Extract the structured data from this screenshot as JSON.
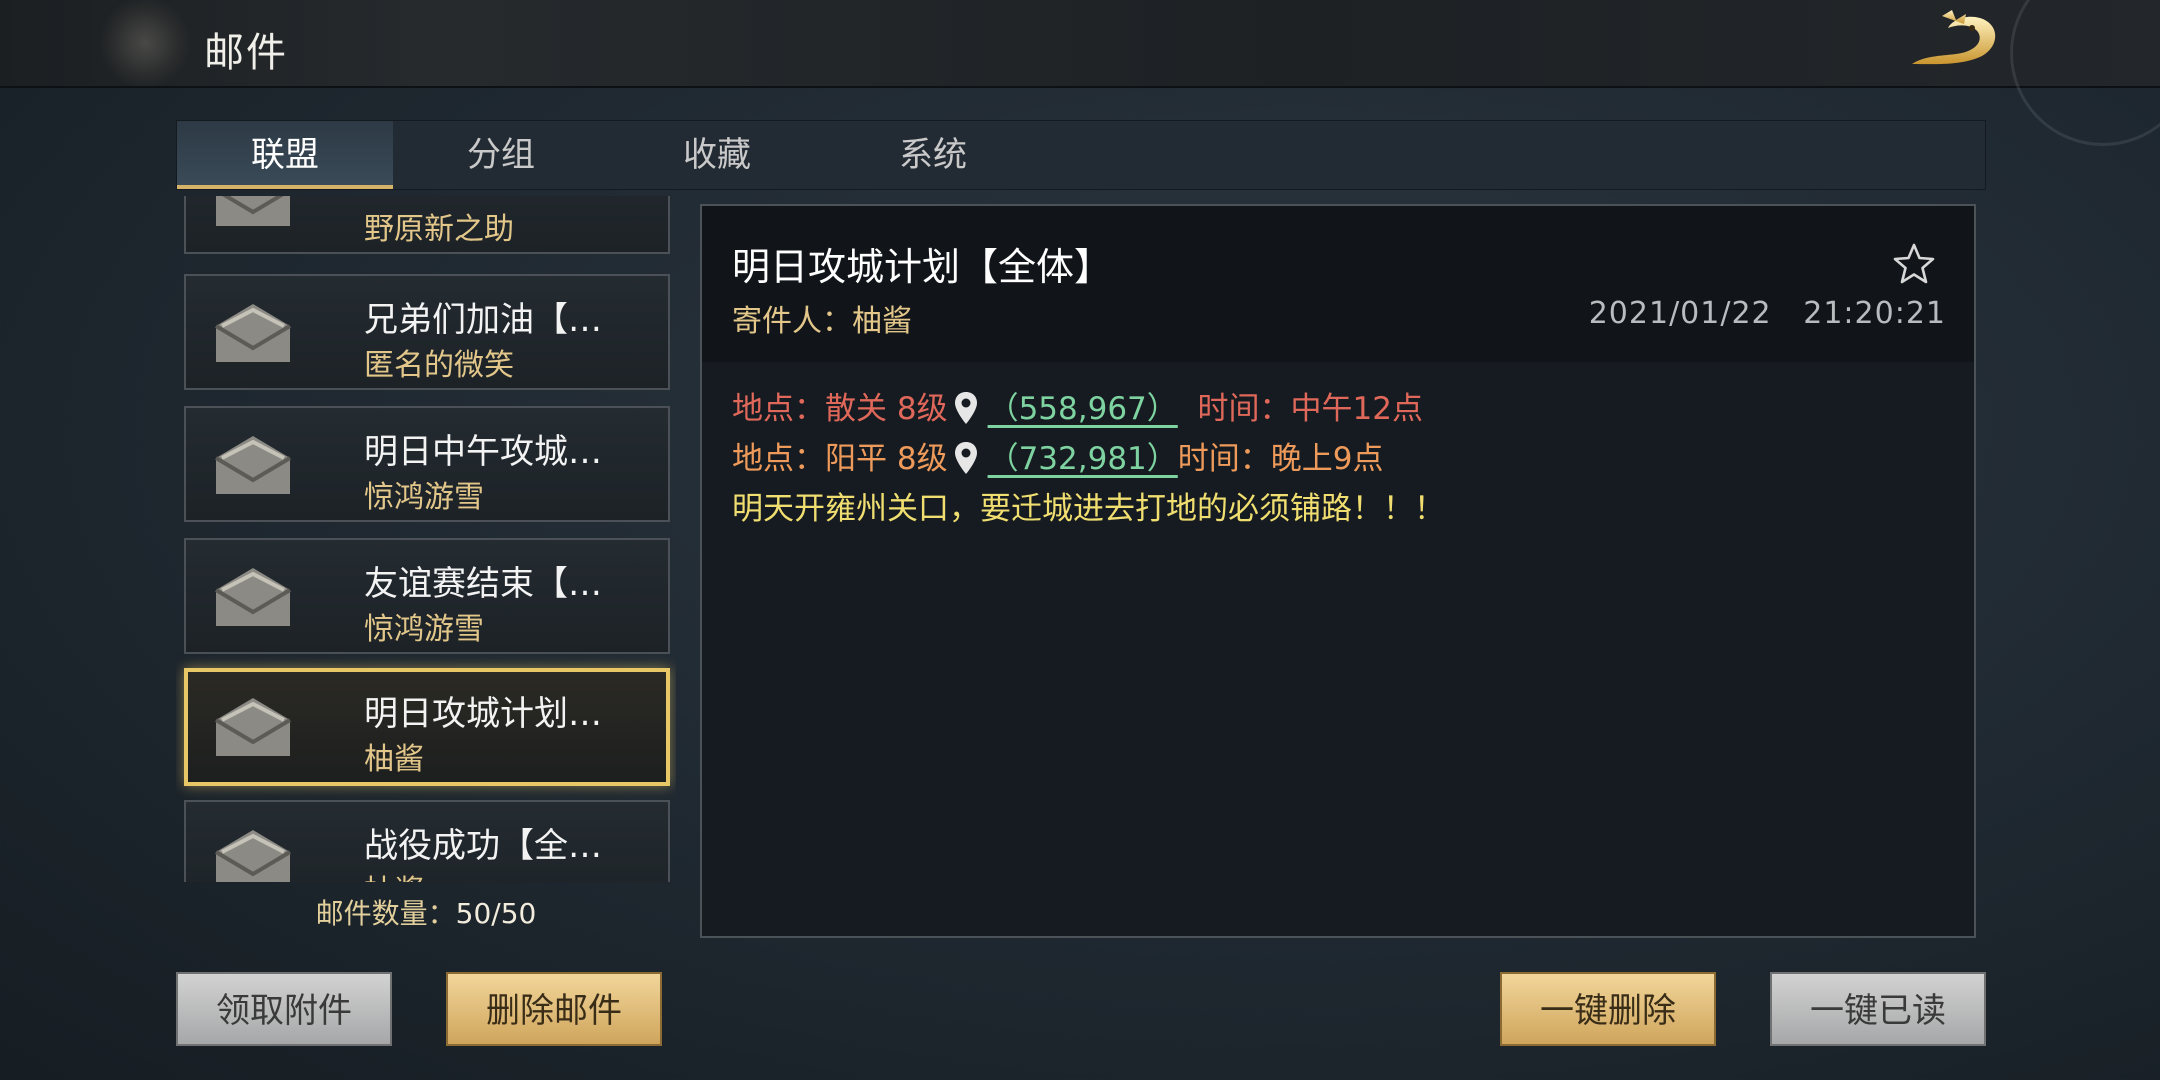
{
  "header": {
    "title": "邮件"
  },
  "tabs": [
    {
      "label": "联盟",
      "active": true
    },
    {
      "label": "分组",
      "active": false
    },
    {
      "label": "收藏",
      "active": false
    },
    {
      "label": "系统",
      "active": false
    }
  ],
  "mails": [
    {
      "subject": "",
      "sender": "野原新之助"
    },
    {
      "subject": "兄弟们加油【…",
      "sender": "匿名的微笑"
    },
    {
      "subject": "明日中午攻城…",
      "sender": "惊鸿游雪"
    },
    {
      "subject": "友谊赛结束【…",
      "sender": "惊鸿游雪"
    },
    {
      "subject": "明日攻城计划…",
      "sender": "柚酱",
      "selected": true
    },
    {
      "subject": "战役成功【全…",
      "sender": "柚酱"
    }
  ],
  "mail_count": {
    "label": "邮件数量：",
    "value": "50/50"
  },
  "detail": {
    "title": "明日攻城计划【全体】",
    "from_label": "寄件人：",
    "from_name": "柚酱",
    "date": "2021/01/22",
    "time": "21:20:21",
    "line1": {
      "loc": "地点：散关 8级",
      "coord": "（558,967）",
      "time": "时间：中午12点"
    },
    "line2": {
      "loc": "地点：阳平 8级",
      "coord": "（732,981）",
      "time": "时间：晚上9点"
    },
    "line3": "明天开雍州关口，要迁城进去打地的必须铺路！！！"
  },
  "buttons": {
    "claim": "领取附件",
    "delete": "删除邮件",
    "delete_all": "一键删除",
    "read_all": "一键已读"
  },
  "colors": {
    "accent_gold": "#e8c766",
    "link_green": "#7ed3a0",
    "text_red": "#e0685a",
    "text_orange": "#ee9a5a",
    "text_yellow": "#f0de70"
  },
  "icons": [
    "dragon-logo-icon",
    "envelope-icon",
    "star-icon",
    "location-pin-icon"
  ]
}
